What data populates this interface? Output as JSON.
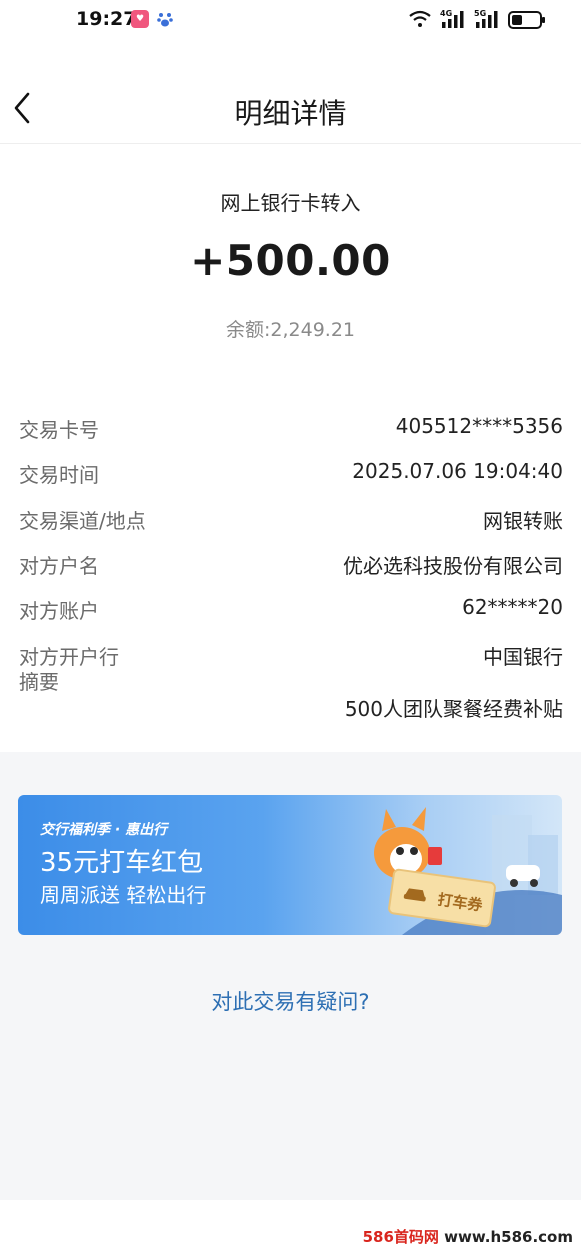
{
  "status_bar": {
    "time": "19:27",
    "network_left": "4G",
    "network_right": "5G",
    "icons": [
      "shopping-app-icon",
      "baidu-icon",
      "wifi-icon",
      "signal-icon",
      "battery-icon"
    ]
  },
  "nav": {
    "title": "明细详情",
    "back_icon": "chevron-left-icon"
  },
  "summary": {
    "type": "网上银行卡转入",
    "amount": "+500.00",
    "balance": "余额:2,249.21"
  },
  "details": [
    {
      "label": "交易卡号",
      "value": "405512****5356"
    },
    {
      "label": "交易时间",
      "value": "2025.07.06 19:04:40"
    },
    {
      "label": "交易渠道/地点",
      "value": "网银转账"
    },
    {
      "label": "对方户名",
      "value": "优必选科技股份有限公司"
    },
    {
      "label": "对方账户",
      "value": "62*****20"
    },
    {
      "label": "对方开户行",
      "value": "中国银行"
    },
    {
      "label": "摘要",
      "value": "500人团队聚餐经费补贴"
    }
  ],
  "banner": {
    "tag": "交行福利季 · 惠出行",
    "title": "35元打车红包",
    "subtitle": "周周派送 轻松出行",
    "ticket_label": "打车券"
  },
  "question_link": "对此交易有疑问?",
  "watermark": {
    "prefix": "586首码网",
    "site": " www.h586.com"
  },
  "colors": {
    "link": "#2d6fb3",
    "banner_start": "#3c8de8",
    "banner_end": "#d3e6f8",
    "background_gray": "#f5f6f8"
  }
}
